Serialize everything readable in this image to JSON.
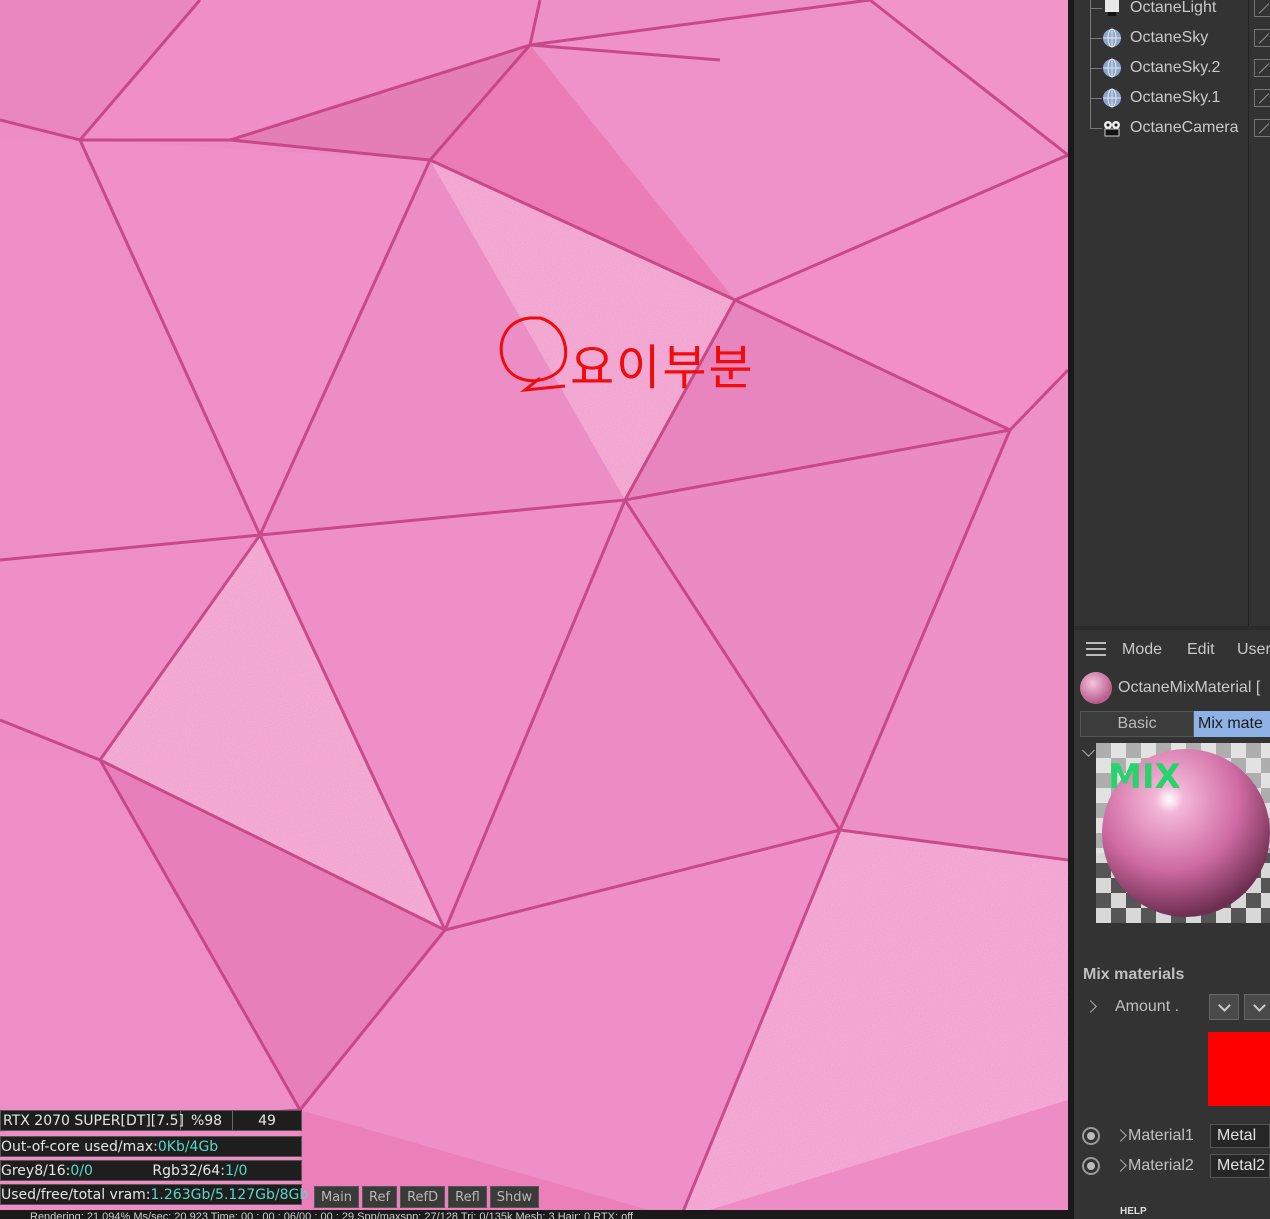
{
  "viewport": {
    "annotation_text": "요이부분",
    "hud": {
      "gpu_label": "RTX 2070 SUPER[DT][7.5]",
      "gpu_usage": "%98",
      "gpu_temp": "49",
      "ooc_label": "Out-of-core used/max:",
      "ooc_value": "0Kb/4Gb",
      "grey_label": "Grey8/16: ",
      "grey_value": "0/0",
      "rgb_label": "Rgb32/64: ",
      "rgb_value": "1/0",
      "vram_label": "Used/free/total vram: ",
      "vram_value": "1.263Gb/5.127Gb/8Gb"
    },
    "pass_tabs": [
      "Main",
      "Ref",
      "RefD",
      "Refl",
      "Shdw"
    ],
    "bottom_status": "Rendering: 21.094%  Ms/sec: 20.923  Time: 00 : 00 : 06/00 : 00 : 29  Spp/maxspp: 27/128  Tri: 0/135k  Mesh: 3  Hair: 0  RTX: off"
  },
  "objects": [
    {
      "name": "OctaneLight",
      "icon": "light-icon"
    },
    {
      "name": "OctaneSky",
      "icon": "sky-sphere-icon"
    },
    {
      "name": "OctaneSky.2",
      "icon": "sky-sphere-icon"
    },
    {
      "name": "OctaneSky.1",
      "icon": "sky-sphere-icon"
    },
    {
      "name": "OctaneCamera",
      "icon": "camera-icon"
    }
  ],
  "attributes": {
    "menu": [
      "Mode",
      "Edit",
      "User"
    ],
    "material_name": "OctaneMixMaterial [",
    "tabs": {
      "basic": "Basic",
      "mix": "Mix mate"
    },
    "preview_label": "MIX",
    "section_title": "Mix materials",
    "amount_label": "Amount .",
    "material1_label": "Material1",
    "material1_value": "Metal",
    "material2_label": "Material2",
    "material2_value": "Metal2",
    "help_label": "HELP",
    "swatch_color": "#ff0000"
  }
}
